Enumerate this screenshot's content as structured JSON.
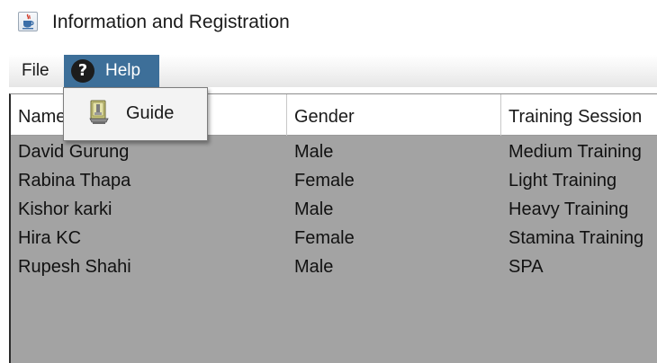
{
  "window": {
    "title": "Information and Registration",
    "icon": "java-cup-icon"
  },
  "menubar": {
    "items": [
      {
        "label": "File"
      },
      {
        "label": "Help",
        "icon": "help-question-icon",
        "active": true
      }
    ]
  },
  "help_menu": {
    "items": [
      {
        "label": "Guide",
        "icon": "guide-book-icon"
      }
    ]
  },
  "table": {
    "columns": [
      "Name",
      "Gender",
      "Training Session"
    ],
    "rows": [
      {
        "name": "David Gurung",
        "gender": "Male",
        "session": "Medium Training"
      },
      {
        "name": "Rabina Thapa",
        "gender": "Female",
        "session": "Light Training"
      },
      {
        "name": "Kishor karki",
        "gender": "Male",
        "session": "Heavy Training"
      },
      {
        "name": "Hira KC",
        "gender": "Female",
        "session": "Stamina Training"
      },
      {
        "name": "Rupesh Shahi",
        "gender": "Male",
        "session": "SPA"
      }
    ]
  },
  "colors": {
    "menu_highlight": "#3d6f99",
    "table_background": "#a3a3a3",
    "header_background": "#ffffff"
  }
}
